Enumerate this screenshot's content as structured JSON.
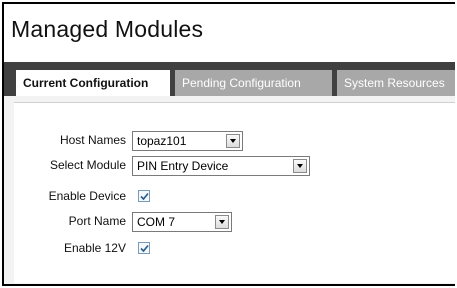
{
  "page": {
    "title": "Managed Modules"
  },
  "tabs": [
    {
      "label": "Current Configuration",
      "active": true
    },
    {
      "label": "Pending Configuration",
      "active": false
    },
    {
      "label": "System Resources",
      "active": false
    }
  ],
  "form": {
    "host_names_label": "Host Names",
    "host_names_value": "topaz101",
    "select_module_label": "Select Module",
    "select_module_value": "PIN Entry Device",
    "enable_device_label": "Enable Device",
    "enable_device_checked": true,
    "port_name_label": "Port Name",
    "port_name_value": "COM 7",
    "enable_12v_label": "Enable 12V",
    "enable_12v_checked": true
  },
  "colors": {
    "tabbar": "#404040",
    "inactive_tab": "#a8a8a8",
    "checkmark": "#2a5a8a"
  }
}
